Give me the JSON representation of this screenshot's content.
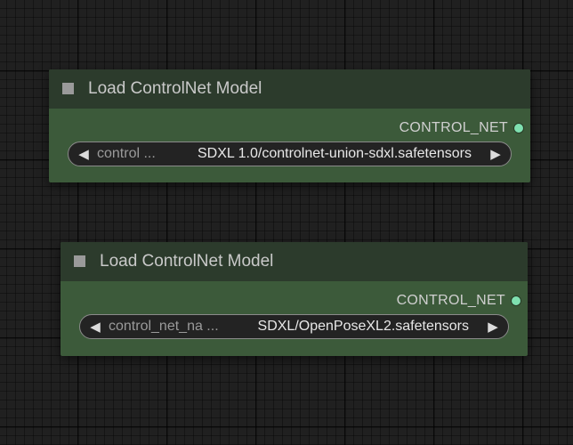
{
  "nodes": [
    {
      "title": "Load ControlNet Model",
      "output_label": "CONTROL_NET",
      "widget": {
        "name": "control ...",
        "value": "SDXL 1.0/controlnet-union-sdxl.safetensors"
      }
    },
    {
      "title": "Load ControlNet Model",
      "output_label": "CONTROL_NET",
      "widget": {
        "name": "control_net_na ...",
        "value": "SDXL/OpenPoseXL2.safetensors"
      }
    }
  ],
  "icons": {
    "collapse": "square-toggle-icon",
    "output_slot": "output-slot-dot-icon",
    "decrement": "triangle-left-icon",
    "increment": "triangle-right-icon"
  },
  "colors": {
    "canvas_bg": "#202020",
    "node_body": "#3c5a3a",
    "node_header": "#2c3b2c",
    "slot_control_net": "#7fe0b0"
  }
}
